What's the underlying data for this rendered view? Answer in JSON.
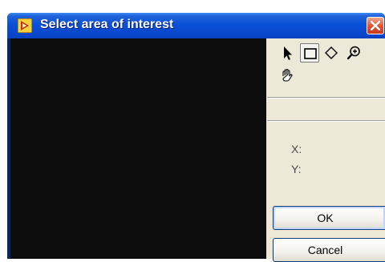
{
  "window": {
    "title": "Select area of interest",
    "icons": {
      "app": "labview-icon",
      "close": "close-icon"
    }
  },
  "tools": [
    {
      "name": "pointer-tool",
      "icon": "arrow-cursor-icon",
      "selected": false
    },
    {
      "name": "rectangle-tool",
      "icon": "rectangle-icon",
      "selected": true
    },
    {
      "name": "rotated-rectangle-tool",
      "icon": "diamond-icon",
      "selected": false
    },
    {
      "name": "zoom-tool",
      "icon": "zoom-icon",
      "selected": false
    },
    {
      "name": "pan-tool",
      "icon": "hand-icon",
      "selected": false
    }
  ],
  "coordinates": {
    "x_label": "X:",
    "y_label": "Y:"
  },
  "buttons": {
    "ok": "OK",
    "cancel": "Cancel"
  },
  "colors": {
    "titlebar": "#0a50d8",
    "panel": "#ece9d8",
    "viewer": "#0c0c0c",
    "close": "#e0522f"
  }
}
